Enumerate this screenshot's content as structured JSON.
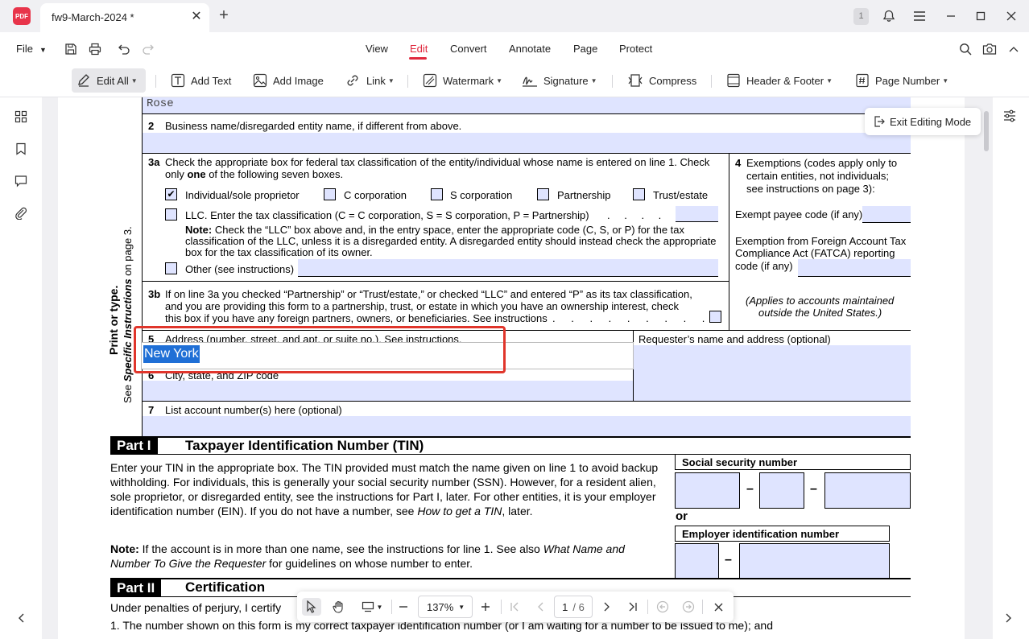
{
  "app": {
    "logo_text": "PDF"
  },
  "tabs": [
    {
      "label": "fw9-March-2024 *"
    }
  ],
  "titlebar": {
    "page_badge": "1"
  },
  "menu": {
    "file": "File",
    "main_tabs": [
      "View",
      "Edit",
      "Convert",
      "Annotate",
      "Page",
      "Protect"
    ],
    "active_tab": "Edit"
  },
  "toolbar": {
    "edit_all": "Edit All",
    "add_text": "Add Text",
    "add_image": "Add Image",
    "link": "Link",
    "watermark": "Watermark",
    "signature": "Signature",
    "compress": "Compress",
    "header_footer": "Header & Footer",
    "page_number": "Page Number"
  },
  "exit_editing": "Exit Editing Mode",
  "form": {
    "line1_value": "Rose",
    "line2": {
      "num": "2",
      "text": "Business name/disregarded entity name, if different from above."
    },
    "line3a": {
      "num": "3a",
      "text1": "Check the appropriate box for federal tax classification of the entity/individual whose name is entered on line 1. Check",
      "text2_a": "only ",
      "text2_b": "one",
      "text2_c": " of the following seven boxes.",
      "options": [
        "Individual/sole proprietor",
        "C corporation",
        "S corporation",
        "Partnership",
        "Trust/estate"
      ],
      "checked": "Individual/sole proprietor",
      "llc": "LLC. Enter the tax classification (C = C corporation, S = S corporation, P = Partnership)",
      "llc_dots": ". . . . .",
      "note_label": "Note:",
      "note1": "Check the “LLC” box above and, in the entry space, enter the appropriate code (C, S, or P) for the tax",
      "note2": "classification of the LLC, unless it is a disregarded entity. A disregarded entity should instead check the appropriate",
      "note3": "box for the tax classification of its owner.",
      "other": "Other (see instructions)"
    },
    "line4": {
      "num": "4",
      "text1": "Exemptions (codes apply only to",
      "text2": "certain entities, not individuals;",
      "text3": "see instructions on page 3):",
      "exempt_payee": "Exempt payee code (if any)",
      "fatca1": "Exemption from Foreign Account Tax",
      "fatca2": "Compliance Act (FATCA) reporting",
      "fatca3": "code (if any)",
      "applies1": "(Applies to accounts maintained",
      "applies2": "outside the United States.)"
    },
    "line3b": {
      "num": "3b",
      "text1": "If on line 3a you checked “Partnership” or “Trust/estate,” or checked “LLC” and entered “P” as its tax classification,",
      "text2": "and you are providing this form to a partnership, trust, or estate in which you have an ownership interest, check",
      "text3": "this box if you have any foreign partners, owners, or beneficiaries. See instructions",
      "dots": ". . . . . . . . ."
    },
    "line5": {
      "num": "5",
      "text": "Address (number, street, and apt. or suite no.). See instructions.",
      "value": "New York"
    },
    "line6": {
      "num": "6",
      "text": "City, state, and ZIP code"
    },
    "requester": "Requester’s name and address (optional)",
    "line7": {
      "num": "7",
      "text": "List account number(s) here (optional)"
    },
    "side_label": {
      "line1": "Print or type.",
      "line2_a": "See ",
      "line2_b": "Specific Instructions",
      "line2_c": " on page 3."
    }
  },
  "part1": {
    "label": "Part I",
    "title": "Taxpayer Identification Number (TIN)",
    "para1": "Enter your TIN in the appropriate box. The TIN provided must match the name given on line 1 to avoid backup withholding. For individuals, this is generally your social security number (SSN). However, for a resident alien, sole proprietor, or disregarded entity, see the instructions for Part I, later. For other entities, it is your employer identification number (EIN). If you do not have a number, see ",
    "para1_italic": "How to get a TIN",
    "para1_end": ", later.",
    "note_label": "Note:",
    "note_text": " If the account is in more than one name, see the instructions for line 1. See also ",
    "note_italic": "What Name and Number To Give the Requester",
    "note_end": " for guidelines on whose number to enter.",
    "ssn_label": "Social security number",
    "or": "or",
    "ein_label": "Employer identification number",
    "dash": "–"
  },
  "part2": {
    "label": "Part II",
    "title": "Certification",
    "para1": "Under penalties of perjury, I certify",
    "item1": "1. The number shown on this form is my correct taxpayer identification number (or I am waiting for a number to be issued to me); and"
  },
  "bottom_bar": {
    "zoom": "137%",
    "page_current": "1",
    "page_total": "/ 6"
  }
}
